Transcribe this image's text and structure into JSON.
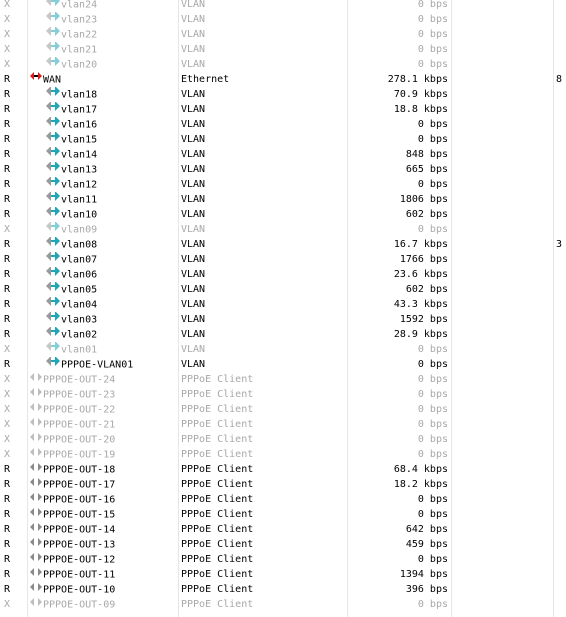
{
  "colors": {
    "disabled_text": "#a8a8a8",
    "enabled_text": "#000000",
    "wan_icon": "#d81e1e",
    "vlan_icon": "#1fa7b8",
    "pppoe_icon": "#8a8a8a"
  },
  "rows": [
    {
      "flag": "X",
      "name": "vlan24",
      "type": "VLAN",
      "rx": "0 bps",
      "tx": "",
      "icon": "vlan-icon",
      "indent": true,
      "disabled": true
    },
    {
      "flag": "X",
      "name": "vlan23",
      "type": "VLAN",
      "rx": "0 bps",
      "tx": "",
      "icon": "vlan-icon",
      "indent": true,
      "disabled": true
    },
    {
      "flag": "X",
      "name": "vlan22",
      "type": "VLAN",
      "rx": "0 bps",
      "tx": "",
      "icon": "vlan-icon",
      "indent": true,
      "disabled": true
    },
    {
      "flag": "X",
      "name": "vlan21",
      "type": "VLAN",
      "rx": "0 bps",
      "tx": "",
      "icon": "vlan-icon",
      "indent": true,
      "disabled": true
    },
    {
      "flag": "X",
      "name": "vlan20",
      "type": "VLAN",
      "rx": "0 bps",
      "tx": "",
      "icon": "vlan-icon",
      "indent": true,
      "disabled": true
    },
    {
      "flag": "R",
      "name": "WAN",
      "type": "Ethernet",
      "rx": "278.1 kbps",
      "tx": "8",
      "icon": "wan-icon",
      "indent": false,
      "disabled": false
    },
    {
      "flag": "R",
      "name": "vlan18",
      "type": "VLAN",
      "rx": "70.9 kbps",
      "tx": "",
      "icon": "vlan-icon",
      "indent": true,
      "disabled": false
    },
    {
      "flag": "R",
      "name": "vlan17",
      "type": "VLAN",
      "rx": "18.8 kbps",
      "tx": "",
      "icon": "vlan-icon",
      "indent": true,
      "disabled": false
    },
    {
      "flag": "R",
      "name": "vlan16",
      "type": "VLAN",
      "rx": "0 bps",
      "tx": "",
      "icon": "vlan-icon",
      "indent": true,
      "disabled": false
    },
    {
      "flag": "R",
      "name": "vlan15",
      "type": "VLAN",
      "rx": "0 bps",
      "tx": "",
      "icon": "vlan-icon",
      "indent": true,
      "disabled": false
    },
    {
      "flag": "R",
      "name": "vlan14",
      "type": "VLAN",
      "rx": "848 bps",
      "tx": "",
      "icon": "vlan-icon",
      "indent": true,
      "disabled": false
    },
    {
      "flag": "R",
      "name": "vlan13",
      "type": "VLAN",
      "rx": "665 bps",
      "tx": "",
      "icon": "vlan-icon",
      "indent": true,
      "disabled": false
    },
    {
      "flag": "R",
      "name": "vlan12",
      "type": "VLAN",
      "rx": "0 bps",
      "tx": "",
      "icon": "vlan-icon",
      "indent": true,
      "disabled": false
    },
    {
      "flag": "R",
      "name": "vlan11",
      "type": "VLAN",
      "rx": "1806 bps",
      "tx": "",
      "icon": "vlan-icon",
      "indent": true,
      "disabled": false
    },
    {
      "flag": "R",
      "name": "vlan10",
      "type": "VLAN",
      "rx": "602 bps",
      "tx": "",
      "icon": "vlan-icon",
      "indent": true,
      "disabled": false
    },
    {
      "flag": "X",
      "name": "vlan09",
      "type": "VLAN",
      "rx": "0 bps",
      "tx": "",
      "icon": "vlan-icon",
      "indent": true,
      "disabled": true
    },
    {
      "flag": "R",
      "name": "vlan08",
      "type": "VLAN",
      "rx": "16.7 kbps",
      "tx": "3",
      "icon": "vlan-icon",
      "indent": true,
      "disabled": false
    },
    {
      "flag": "R",
      "name": "vlan07",
      "type": "VLAN",
      "rx": "1766 bps",
      "tx": "",
      "icon": "vlan-icon",
      "indent": true,
      "disabled": false
    },
    {
      "flag": "R",
      "name": "vlan06",
      "type": "VLAN",
      "rx": "23.6 kbps",
      "tx": "",
      "icon": "vlan-icon",
      "indent": true,
      "disabled": false
    },
    {
      "flag": "R",
      "name": "vlan05",
      "type": "VLAN",
      "rx": "602 bps",
      "tx": "",
      "icon": "vlan-icon",
      "indent": true,
      "disabled": false
    },
    {
      "flag": "R",
      "name": "vlan04",
      "type": "VLAN",
      "rx": "43.3 kbps",
      "tx": "",
      "icon": "vlan-icon",
      "indent": true,
      "disabled": false
    },
    {
      "flag": "R",
      "name": "vlan03",
      "type": "VLAN",
      "rx": "1592 bps",
      "tx": "",
      "icon": "vlan-icon",
      "indent": true,
      "disabled": false
    },
    {
      "flag": "R",
      "name": "vlan02",
      "type": "VLAN",
      "rx": "28.9 kbps",
      "tx": "",
      "icon": "vlan-icon",
      "indent": true,
      "disabled": false
    },
    {
      "flag": "X",
      "name": "vlan01",
      "type": "VLAN",
      "rx": "0 bps",
      "tx": "",
      "icon": "vlan-icon",
      "indent": true,
      "disabled": true
    },
    {
      "flag": "R",
      "name": "PPPOE-VLAN01",
      "type": "VLAN",
      "rx": "0 bps",
      "tx": "",
      "icon": "vlan-icon",
      "indent": true,
      "disabled": false
    },
    {
      "flag": "X",
      "name": "PPPOE-OUT-24",
      "type": "PPPoE Client",
      "rx": "0 bps",
      "tx": "",
      "icon": "pppoe-icon",
      "indent": false,
      "disabled": true
    },
    {
      "flag": "X",
      "name": "PPPOE-OUT-23",
      "type": "PPPoE Client",
      "rx": "0 bps",
      "tx": "",
      "icon": "pppoe-icon",
      "indent": false,
      "disabled": true
    },
    {
      "flag": "X",
      "name": "PPPOE-OUT-22",
      "type": "PPPoE Client",
      "rx": "0 bps",
      "tx": "",
      "icon": "pppoe-icon",
      "indent": false,
      "disabled": true
    },
    {
      "flag": "X",
      "name": "PPPOE-OUT-21",
      "type": "PPPoE Client",
      "rx": "0 bps",
      "tx": "",
      "icon": "pppoe-icon",
      "indent": false,
      "disabled": true
    },
    {
      "flag": "X",
      "name": "PPPOE-OUT-20",
      "type": "PPPoE Client",
      "rx": "0 bps",
      "tx": "",
      "icon": "pppoe-icon",
      "indent": false,
      "disabled": true
    },
    {
      "flag": "X",
      "name": "PPPOE-OUT-19",
      "type": "PPPoE Client",
      "rx": "0 bps",
      "tx": "",
      "icon": "pppoe-icon",
      "indent": false,
      "disabled": true
    },
    {
      "flag": "R",
      "name": "PPPOE-OUT-18",
      "type": "PPPoE Client",
      "rx": "68.4 kbps",
      "tx": "",
      "icon": "pppoe-icon",
      "indent": false,
      "disabled": false
    },
    {
      "flag": "R",
      "name": "PPPOE-OUT-17",
      "type": "PPPoE Client",
      "rx": "18.2 kbps",
      "tx": "",
      "icon": "pppoe-icon",
      "indent": false,
      "disabled": false
    },
    {
      "flag": "R",
      "name": "PPPOE-OUT-16",
      "type": "PPPoE Client",
      "rx": "0 bps",
      "tx": "",
      "icon": "pppoe-icon",
      "indent": false,
      "disabled": false
    },
    {
      "flag": "R",
      "name": "PPPOE-OUT-15",
      "type": "PPPoE Client",
      "rx": "0 bps",
      "tx": "",
      "icon": "pppoe-icon",
      "indent": false,
      "disabled": false
    },
    {
      "flag": "R",
      "name": "PPPOE-OUT-14",
      "type": "PPPoE Client",
      "rx": "642 bps",
      "tx": "",
      "icon": "pppoe-icon",
      "indent": false,
      "disabled": false
    },
    {
      "flag": "R",
      "name": "PPPOE-OUT-13",
      "type": "PPPoE Client",
      "rx": "459 bps",
      "tx": "",
      "icon": "pppoe-icon",
      "indent": false,
      "disabled": false
    },
    {
      "flag": "R",
      "name": "PPPOE-OUT-12",
      "type": "PPPoE Client",
      "rx": "0 bps",
      "tx": "",
      "icon": "pppoe-icon",
      "indent": false,
      "disabled": false
    },
    {
      "flag": "R",
      "name": "PPPOE-OUT-11",
      "type": "PPPoE Client",
      "rx": "1394 bps",
      "tx": "",
      "icon": "pppoe-icon",
      "indent": false,
      "disabled": false
    },
    {
      "flag": "R",
      "name": "PPPOE-OUT-10",
      "type": "PPPoE Client",
      "rx": "396 bps",
      "tx": "",
      "icon": "pppoe-icon",
      "indent": false,
      "disabled": false
    },
    {
      "flag": "X",
      "name": "PPPOE-OUT-09",
      "type": "PPPoE Client",
      "rx": "0 bps",
      "tx": "",
      "icon": "pppoe-icon",
      "indent": false,
      "disabled": true
    }
  ]
}
